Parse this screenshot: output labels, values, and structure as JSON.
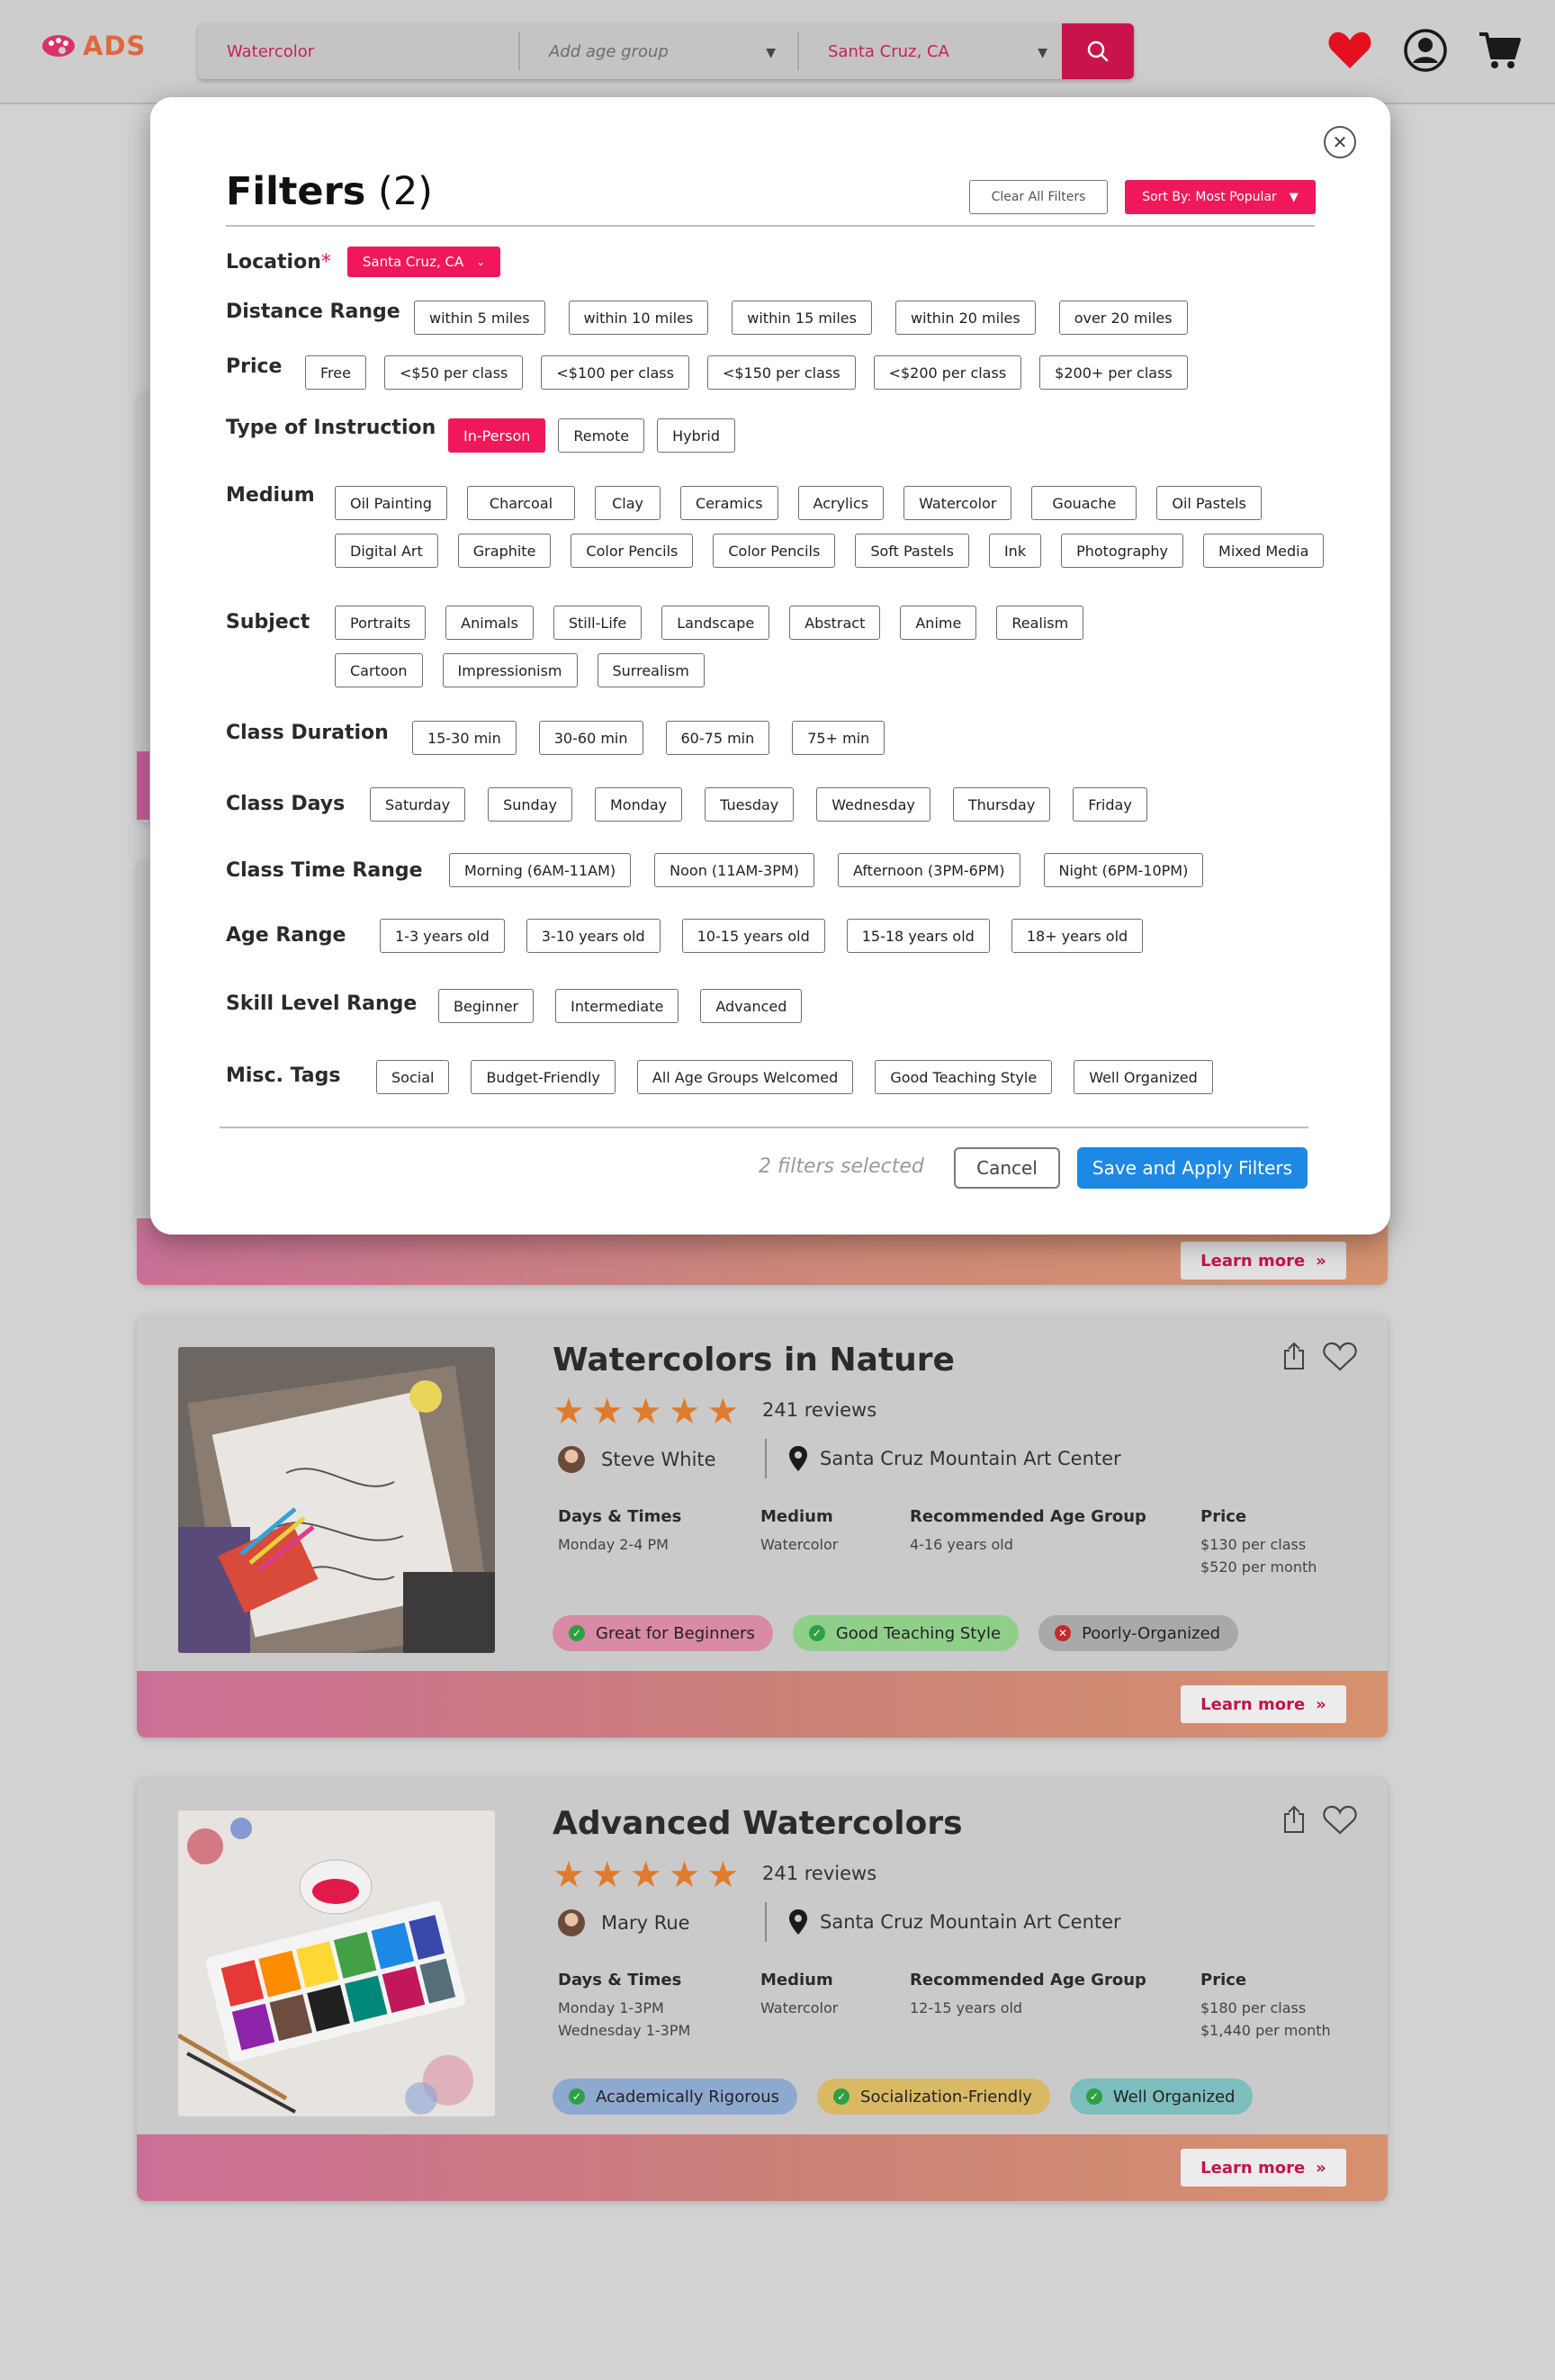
{
  "header": {
    "logo_text": "ADS",
    "search_query": "Watercolor",
    "age_placeholder": "Add age group",
    "location": "Santa Cruz, CA"
  },
  "modal": {
    "title": "Filters",
    "count": "(2)",
    "clear_label": "Clear All Filters",
    "sort_label": "Sort By: Most Popular",
    "location_label": "Location",
    "location_required": "*",
    "location_value": "Santa Cruz, CA",
    "sections": {
      "distance": {
        "label": "Distance Range",
        "options": [
          "within 5 miles",
          "within 10 miles",
          "within 15 miles",
          "within 20 miles",
          "over 20 miles"
        ]
      },
      "price": {
        "label": "Price",
        "options": [
          "Free",
          "<$50 per class",
          "<$100 per class",
          "<$150 per class",
          "<$200 per class",
          "$200+ per class"
        ]
      },
      "instruction": {
        "label": "Type of Instruction",
        "options": [
          "In-Person",
          "Remote",
          "Hybrid"
        ],
        "selected": "In-Person"
      },
      "medium": {
        "label": "Medium",
        "row1": [
          "Oil Painting",
          "Charcoal",
          "Clay",
          "Ceramics",
          "Acrylics",
          "Watercolor",
          "Gouache",
          "Oil Pastels"
        ],
        "row2": [
          "Digital Art",
          "Graphite",
          "Color Pencils",
          "Color Pencils",
          "Soft Pastels",
          "Ink",
          "Photography",
          "Mixed Media"
        ]
      },
      "subject": {
        "label": "Subject",
        "row1": [
          "Portraits",
          "Animals",
          "Still-Life",
          "Landscape",
          "Abstract",
          "Anime",
          "Realism"
        ],
        "row2": [
          "Cartoon",
          "Impressionism",
          "Surrealism"
        ]
      },
      "duration": {
        "label": "Class Duration",
        "options": [
          "15-30 min",
          "30-60 min",
          "60-75 min",
          "75+ min"
        ]
      },
      "days": {
        "label": "Class Days",
        "options": [
          "Saturday",
          "Sunday",
          "Monday",
          "Tuesday",
          "Wednesday",
          "Thursday",
          "Friday"
        ]
      },
      "time": {
        "label": "Class Time Range",
        "options": [
          "Morning (6AM-11AM)",
          "Noon (11AM-3PM)",
          "Afternoon (3PM-6PM)",
          "Night (6PM-10PM)"
        ]
      },
      "age": {
        "label": "Age Range",
        "options": [
          "1-3 years old",
          "3-10 years old",
          "10-15 years old",
          "15-18 years old",
          "18+ years old"
        ]
      },
      "skill": {
        "label": "Skill Level Range",
        "options": [
          "Beginner",
          "Intermediate",
          "Advanced"
        ]
      },
      "misc": {
        "label": "Misc. Tags",
        "options": [
          "Social",
          "Budget-Friendly",
          "All Age Groups Welcomed",
          "Good Teaching Style",
          "Well Organized"
        ]
      }
    },
    "selected_count": "2 filters selected",
    "cancel_label": "Cancel",
    "save_label": "Save and Apply Filters"
  },
  "cards": [
    {
      "title": "Watercolors in Nature",
      "reviews": "241 reviews",
      "instructor": "Steve White",
      "location": "Santa Cruz Mountain Art Center",
      "days_label": "Days & Times",
      "days": [
        "Monday 2-4 PM"
      ],
      "medium_label": "Medium",
      "medium": "Watercolor",
      "age_label": "Recommended Age Group",
      "age": "4-16 years old",
      "price_label": "Price",
      "price": [
        "$130 per class",
        "$520 per month"
      ],
      "tags": [
        {
          "label": "Great for Beginners",
          "color": "#d98aa6",
          "icon": "check-icon"
        },
        {
          "label": "Good Teaching Style",
          "color": "#8fcf8a",
          "icon": "check-icon"
        },
        {
          "label": "Poorly-Organized",
          "color": "#a9a9a9",
          "icon": "x-icon"
        }
      ],
      "learn_more": "Learn more"
    },
    {
      "title": "Advanced Watercolors",
      "reviews": "241 reviews",
      "instructor": "Mary Rue",
      "location": "Santa Cruz Mountain Art Center",
      "days_label": "Days & Times",
      "days": [
        "Monday 1-3PM",
        "Wednesday 1-3PM"
      ],
      "medium_label": "Medium",
      "medium": "Watercolor",
      "age_label": "Recommended Age Group",
      "age": "12-15 years old",
      "price_label": "Price",
      "price": [
        "$180 per class",
        "$1,440 per month"
      ],
      "tags": [
        {
          "label": "Academically Rigorous",
          "color": "#8ea9cf",
          "icon": "check-icon"
        },
        {
          "label": "Socialization-Friendly",
          "color": "#d9b964",
          "icon": "check-icon"
        },
        {
          "label": "Well Organized",
          "color": "#7ebdbd",
          "icon": "check-icon"
        }
      ],
      "learn_more": "Learn more"
    }
  ],
  "ghost_learn_more": "Learn more",
  "colors": {
    "accent": "#f0185a",
    "primary": "#1e88e5",
    "brand": "#e0673e"
  }
}
